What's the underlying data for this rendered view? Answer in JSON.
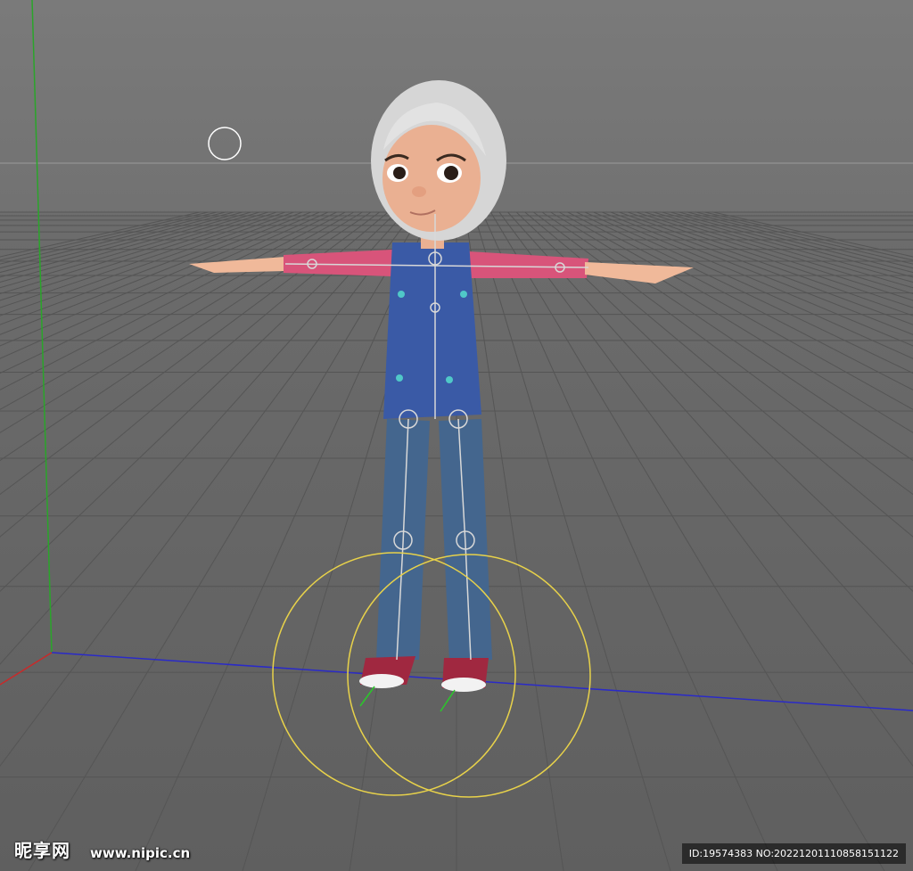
{
  "scene": {
    "character": "character-model",
    "rig": "skeleton-rig",
    "controls": [
      "foot-control-left",
      "foot-control-right",
      "camera-target"
    ],
    "axis_colors": {
      "x": "#2222cc",
      "y": "#22aa22",
      "z": "#cc2222"
    },
    "control_color": "#e8d24a"
  },
  "watermark": {
    "logo_text": "昵享网",
    "site": "www.nipic.cn",
    "id_text": "ID:19574383 NO:20221201110858151122"
  }
}
